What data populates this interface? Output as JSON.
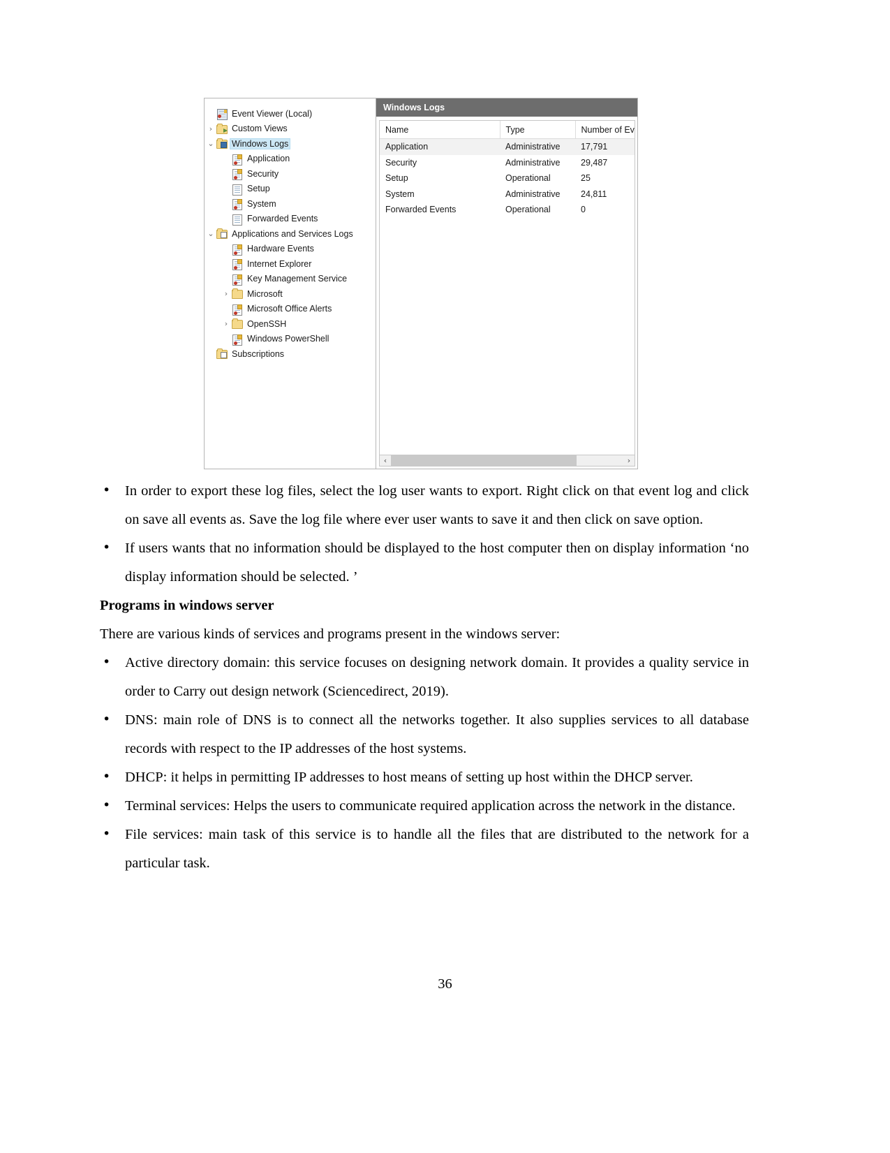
{
  "figure": {
    "tree": {
      "items": [
        {
          "label": "Event Viewer (Local)",
          "icon": "event-viewer-root-icon",
          "indent": 0,
          "twisty": "",
          "selected": false
        },
        {
          "label": "Custom Views",
          "icon": "folder-arrow-icon",
          "indent": 0,
          "twisty": "›",
          "selected": false
        },
        {
          "label": "Windows Logs",
          "icon": "folder-blue-icon",
          "indent": 0,
          "twisty": "⌄",
          "selected": true
        },
        {
          "label": "Application",
          "icon": "log-key-icon",
          "indent": 1,
          "twisty": "",
          "selected": false
        },
        {
          "label": "Security",
          "icon": "log-key-icon",
          "indent": 1,
          "twisty": "",
          "selected": false
        },
        {
          "label": "Setup",
          "icon": "log-icon",
          "indent": 1,
          "twisty": "",
          "selected": false
        },
        {
          "label": "System",
          "icon": "log-key-icon",
          "indent": 1,
          "twisty": "",
          "selected": false
        },
        {
          "label": "Forwarded Events",
          "icon": "log-icon",
          "indent": 1,
          "twisty": "",
          "selected": false
        },
        {
          "label": "Applications and Services Logs",
          "icon": "folder-grid-icon",
          "indent": 0,
          "twisty": "⌄",
          "selected": false
        },
        {
          "label": "Hardware Events",
          "icon": "log-key-icon",
          "indent": 1,
          "twisty": "",
          "selected": false
        },
        {
          "label": "Internet Explorer",
          "icon": "log-key-icon",
          "indent": 1,
          "twisty": "",
          "selected": false
        },
        {
          "label": "Key Management Service",
          "icon": "log-key-icon",
          "indent": 1,
          "twisty": "",
          "selected": false
        },
        {
          "label": "Microsoft",
          "icon": "folder-icon",
          "indent": 1,
          "twisty": "›",
          "selected": false
        },
        {
          "label": "Microsoft Office Alerts",
          "icon": "log-key-icon",
          "indent": 1,
          "twisty": "",
          "selected": false
        },
        {
          "label": "OpenSSH",
          "icon": "folder-icon",
          "indent": 1,
          "twisty": "›",
          "selected": false
        },
        {
          "label": "Windows PowerShell",
          "icon": "log-key-icon",
          "indent": 1,
          "twisty": "",
          "selected": false
        },
        {
          "label": "Subscriptions",
          "icon": "folder-grid-icon",
          "indent": 0,
          "twisty": "",
          "selected": false
        }
      ]
    },
    "list_pane": {
      "title": "Windows Logs",
      "columns": [
        "Name",
        "Type",
        "Number of Events"
      ],
      "rows": [
        {
          "name": "Application",
          "type": "Administrative",
          "number_of_events": "17,791",
          "selected": true
        },
        {
          "name": "Security",
          "type": "Administrative",
          "number_of_events": "29,487",
          "selected": false
        },
        {
          "name": "Setup",
          "type": "Operational",
          "number_of_events": "25",
          "selected": false
        },
        {
          "name": "System",
          "type": "Administrative",
          "number_of_events": "24,811",
          "selected": false
        },
        {
          "name": "Forwarded Events",
          "type": "Operational",
          "number_of_events": "0",
          "selected": false
        }
      ],
      "scrollbar": {
        "left_arrow": "‹",
        "right_arrow": "›"
      }
    }
  },
  "body": {
    "bullets_1": [
      "In order to export these log files, select the log user wants to export. Right click on that event log and click on save all events as. Save the log file where ever user wants to save it and then click on save option.",
      "If users wants that no information should be displayed to the host computer then on display information ‘no display information should be selected. ’"
    ],
    "subheading": "Programs in windows server",
    "intro": "There are various kinds of services and programs present in the windows server:",
    "bullets_2": [
      "Active directory domain: this service focuses on designing network domain. It provides a quality service in order to Carry out design network (Sciencedirect, 2019).",
      "DNS: main role of DNS is to connect all the networks together. It also supplies services to all database records with respect to the IP addresses of the host systems.",
      "DHCP: it helps in permitting IP addresses to host means of setting up host within the DHCP server.",
      "Terminal services: Helps the users to communicate required application across the network in the distance.",
      "File services: main task of this service is to handle all the files that are distributed to the network for a particular task."
    ]
  },
  "page_number": "36",
  "colors": {
    "selection_blue": "#cde8f6",
    "pane_title_gray": "#6d6d6d",
    "row_hover_gray": "#f2f2f2"
  }
}
